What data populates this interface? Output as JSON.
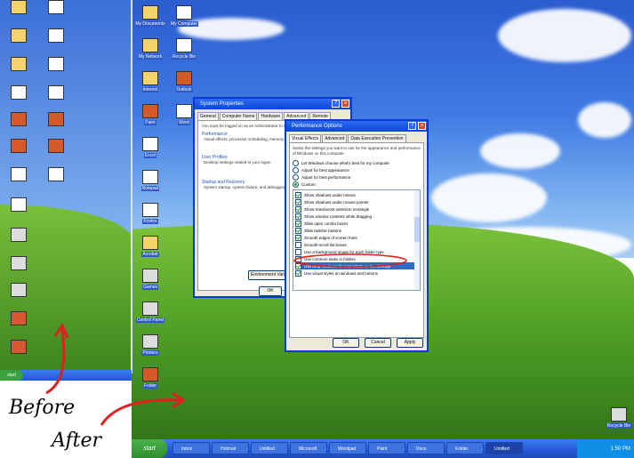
{
  "captions": {
    "before": "Before",
    "after": "After"
  },
  "colors": {
    "accent": "#2457d6",
    "highlight": "#e02020",
    "start": "#3aa13c"
  },
  "taskbar": {
    "start_label": "start",
    "buttons": [
      "Inbox",
      "Hotmail",
      "Untitled",
      "Microsoft",
      "Wordpad",
      "Paint",
      "Docs",
      "Folder",
      "Untitled"
    ],
    "tray_time": "1:50 PM"
  },
  "system_properties": {
    "title": "System Properties",
    "tabs": [
      "General",
      "Computer Name",
      "Hardware",
      "Advanced",
      "Remote"
    ],
    "intro": "You must be logged on as an Administrator to make most of these changes.",
    "performance_heading": "Performance",
    "performance_text": "Visual effects, processor scheduling, memory usage, and virtual memory",
    "user_profiles_heading": "User Profiles",
    "user_profiles_text": "Desktop settings related to your logon",
    "startup_heading": "Startup and Recovery",
    "startup_text": "System startup, system failure, and debugging information",
    "env_button": "Environment Variables",
    "ok_button": "OK"
  },
  "performance_options": {
    "title": "Performance Options",
    "tabs": [
      "Visual Effects",
      "Advanced",
      "Data Execution Prevention"
    ],
    "intro": "Select the settings you want to use for the appearance and performance of Windows on this computer.",
    "radios": [
      {
        "label": "Let Windows choose what's best for my computer",
        "on": false
      },
      {
        "label": "Adjust for best appearance",
        "on": false
      },
      {
        "label": "Adjust for best performance",
        "on": false
      },
      {
        "label": "Custom:",
        "on": true
      }
    ],
    "checks": [
      {
        "label": "Show shadows under menus",
        "on": true
      },
      {
        "label": "Show shadows under mouse pointer",
        "on": true
      },
      {
        "label": "Show translucent selection rectangle",
        "on": true
      },
      {
        "label": "Show window contents while dragging",
        "on": true
      },
      {
        "label": "Slide open combo boxes",
        "on": true
      },
      {
        "label": "Slide taskbar buttons",
        "on": true
      },
      {
        "label": "Smooth edges of screen fonts",
        "on": true
      },
      {
        "label": "Smooth-scroll list boxes",
        "on": false
      },
      {
        "label": "Use a background image for each folder type",
        "on": false
      },
      {
        "label": "Use common tasks in folders",
        "on": false
      },
      {
        "label": "Use drop shadows for icon labels on the desktop",
        "on": true
      },
      {
        "label": "Use visual styles on windows and buttons",
        "on": true
      }
    ],
    "ok_button": "OK",
    "cancel_button": "Cancel",
    "apply_button": "Apply"
  },
  "desktop": {
    "after_icons": [
      "My Documents",
      "My Computer",
      "My Network",
      "Recycle Bin",
      "Internet",
      "Outlook",
      "Paint",
      "Word",
      "Excel",
      "Notepad",
      "Firefox",
      "Acrobat",
      "Games",
      "Control Panel",
      "Printers",
      "Folder"
    ],
    "recycle_label": "Recycle Bin"
  }
}
